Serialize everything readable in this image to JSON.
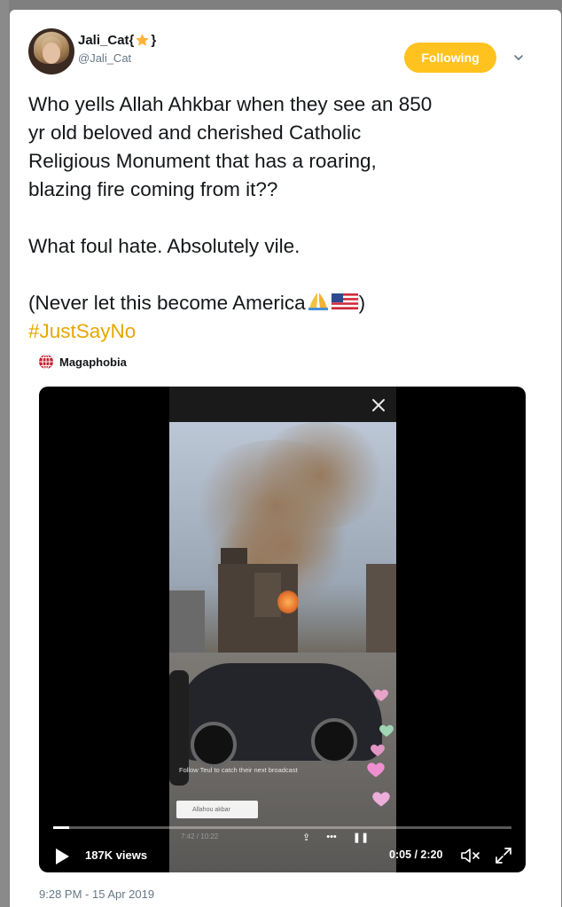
{
  "tweet": {
    "display_name": "Jali_Cat{",
    "display_name_suffix": "}",
    "handle": "@Jali_Cat",
    "follow_label": "Following",
    "text_lines": [
      "Who yells Allah Ahkbar when they see an 850",
      "yr old beloved and cherished Catholic",
      "Religious Monument that has a roaring,",
      "blazing fire coming from it??"
    ],
    "text_line2": "What foul hate. Absolutely vile.",
    "text_line3": "(Never let this become America",
    "text_line3_end": ")",
    "hashtag": "#JustSayNo",
    "source_name": "Magaphobia",
    "timestamp": "9:28 PM - 15 Apr 2019"
  },
  "video": {
    "views": "187K views",
    "time": "0:05 / 2:20",
    "progress": 0.035,
    "inner_follow_note": "Follow Teul to catch their next broadcast",
    "inner_chat": "Allahou akbar",
    "inner_time": "7:42 / 10:22"
  },
  "colors": {
    "accent": "#ffc21f",
    "hashtag": "#e7a700",
    "muted_text": "#657786"
  }
}
